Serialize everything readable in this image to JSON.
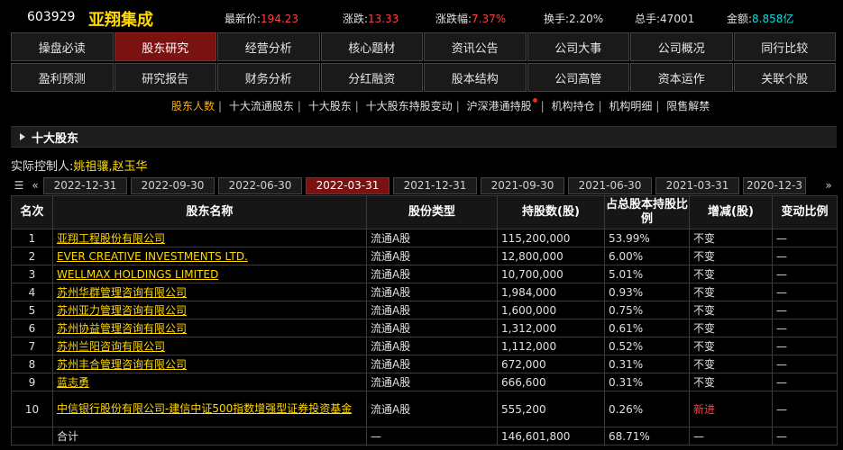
{
  "quote": {
    "code": "603929",
    "name": "亚翔集成",
    "latest_label": "最新价:",
    "latest": "194.23",
    "change_label": "涨跌:",
    "change": "13.33",
    "pct_label": "涨跌幅:",
    "pct": "7.37%",
    "turnover_label": "换手:",
    "turnover": "2.20%",
    "volume_label": "总手:",
    "volume": "47001",
    "amount_label": "金额:",
    "amount": "8.858亿"
  },
  "nav": {
    "row1": [
      "操盘必读",
      "股东研究",
      "经营分析",
      "核心题材",
      "资讯公告",
      "公司大事",
      "公司概况",
      "同行比较"
    ],
    "row2": [
      "盈利预测",
      "研究报告",
      "财务分析",
      "分红融资",
      "股本结构",
      "公司高管",
      "资本运作",
      "关联个股"
    ]
  },
  "sublinks": [
    "股东人数",
    "十大流通股东",
    "十大股东",
    "十大股东持股变动",
    "沪深港通持股",
    "机构持仓",
    "机构明细",
    "限售解禁"
  ],
  "section_title": "十大股东",
  "controller": {
    "label": "实际控制人:",
    "value": "姚祖骧,赵玉华"
  },
  "dates": [
    "2022-12-31",
    "2022-09-30",
    "2022-06-30",
    "2022-03-31",
    "2021-12-31",
    "2021-09-30",
    "2021-06-30",
    "2021-03-31",
    "2020-12-3"
  ],
  "table": {
    "headers": [
      "名次",
      "股东名称",
      "股份类型",
      "持股数(股)",
      "占总股本持股比例",
      "增减(股)",
      "变动比例"
    ],
    "rows": [
      {
        "rank": "1",
        "name": "亚翔工程股份有限公司",
        "type": "流通A股",
        "shares": "115,200,000",
        "ratio": "53.99%",
        "delta": "不变",
        "change": "—"
      },
      {
        "rank": "2",
        "name": "EVER CREATIVE INVESTMENTS LTD.",
        "type": "流通A股",
        "shares": "12,800,000",
        "ratio": "6.00%",
        "delta": "不变",
        "change": "—"
      },
      {
        "rank": "3",
        "name": "WELLMAX HOLDINGS LIMITED",
        "type": "流通A股",
        "shares": "10,700,000",
        "ratio": "5.01%",
        "delta": "不变",
        "change": "—"
      },
      {
        "rank": "4",
        "name": "苏州华群管理咨询有限公司",
        "type": "流通A股",
        "shares": "1,984,000",
        "ratio": "0.93%",
        "delta": "不变",
        "change": "—"
      },
      {
        "rank": "5",
        "name": "苏州亚力管理咨询有限公司",
        "type": "流通A股",
        "shares": "1,600,000",
        "ratio": "0.75%",
        "delta": "不变",
        "change": "—"
      },
      {
        "rank": "6",
        "name": "苏州协益管理咨询有限公司",
        "type": "流通A股",
        "shares": "1,312,000",
        "ratio": "0.61%",
        "delta": "不变",
        "change": "—"
      },
      {
        "rank": "7",
        "name": "苏州兰阳咨询有限公司",
        "type": "流通A股",
        "shares": "1,112,000",
        "ratio": "0.52%",
        "delta": "不变",
        "change": "—"
      },
      {
        "rank": "8",
        "name": "苏州丰合管理咨询有限公司",
        "type": "流通A股",
        "shares": "672,000",
        "ratio": "0.31%",
        "delta": "不变",
        "change": "—"
      },
      {
        "rank": "9",
        "name": "蓝志勇",
        "type": "流通A股",
        "shares": "666,600",
        "ratio": "0.31%",
        "delta": "不变",
        "change": "—"
      },
      {
        "rank": "10",
        "name": "中信银行股份有限公司-建信中证500指数增强型证券投资基金",
        "type": "流通A股",
        "shares": "555,200",
        "ratio": "0.26%",
        "delta": "新进",
        "change": "—"
      }
    ],
    "total": {
      "label": "合计",
      "type": "—",
      "shares": "146,601,800",
      "ratio": "68.71%",
      "delta": "—",
      "change": "—"
    }
  },
  "colors": {
    "accent_active": "#7a1212",
    "price_up": "#ff4040",
    "highlight": "#ffd800"
  }
}
